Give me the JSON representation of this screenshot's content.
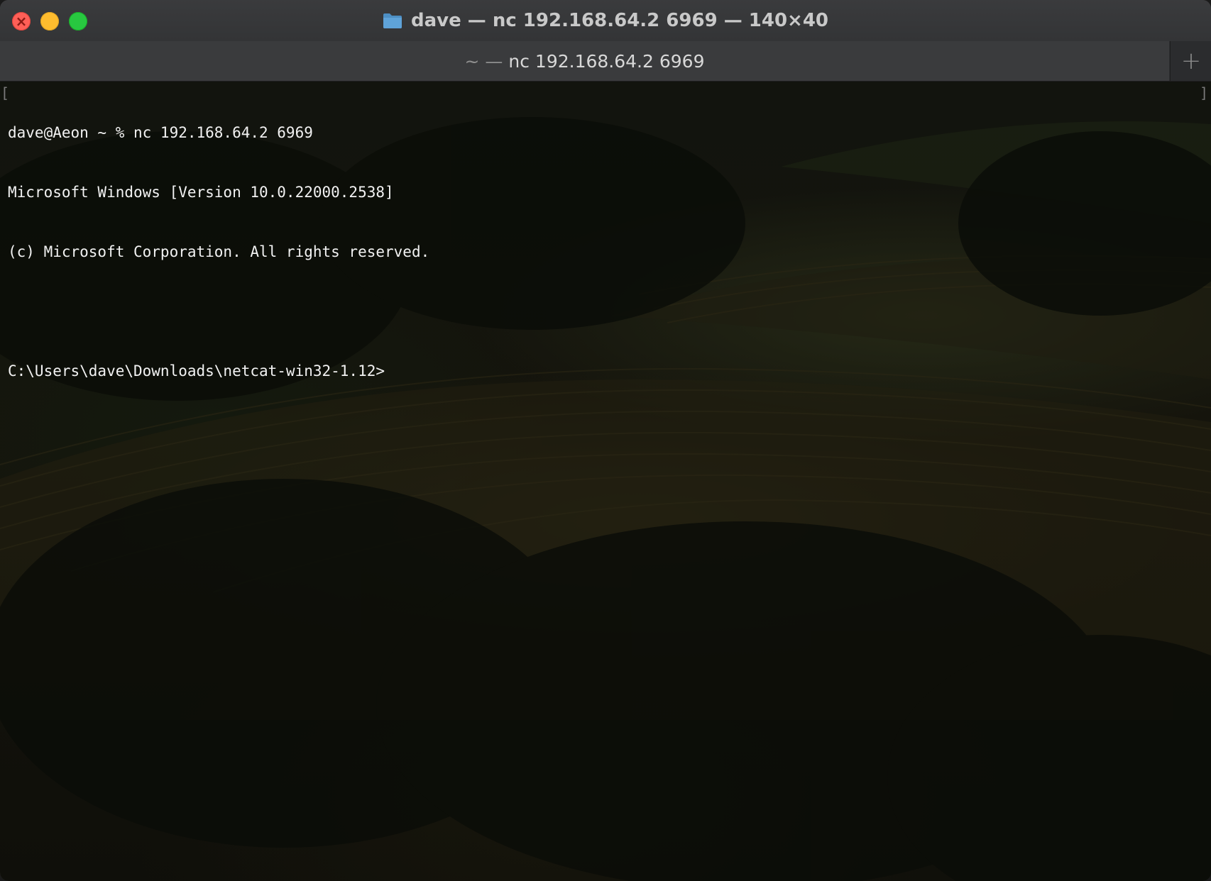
{
  "window": {
    "title": "dave — nc 192.168.64.2 6969 — 140×40",
    "icon": "folder-icon"
  },
  "tabs": [
    {
      "label_prefix": "~ —",
      "label": "nc 192.168.64.2 6969",
      "active": true
    }
  ],
  "new_tab": {
    "label": "+"
  },
  "terminal": {
    "lines": [
      "dave@Aeon ~ % nc 192.168.64.2 6969",
      "Microsoft Windows [Version 10.0.22000.2538]",
      "(c) Microsoft Corporation. All rights reserved.",
      "",
      "C:\\Users\\dave\\Downloads\\netcat-win32-1.12>"
    ],
    "mark_left": "[",
    "mark_right": "]"
  },
  "colors": {
    "text": "#f2f2f2",
    "close": "#ff5f57",
    "minimize": "#febc2e",
    "zoom": "#28c840"
  }
}
